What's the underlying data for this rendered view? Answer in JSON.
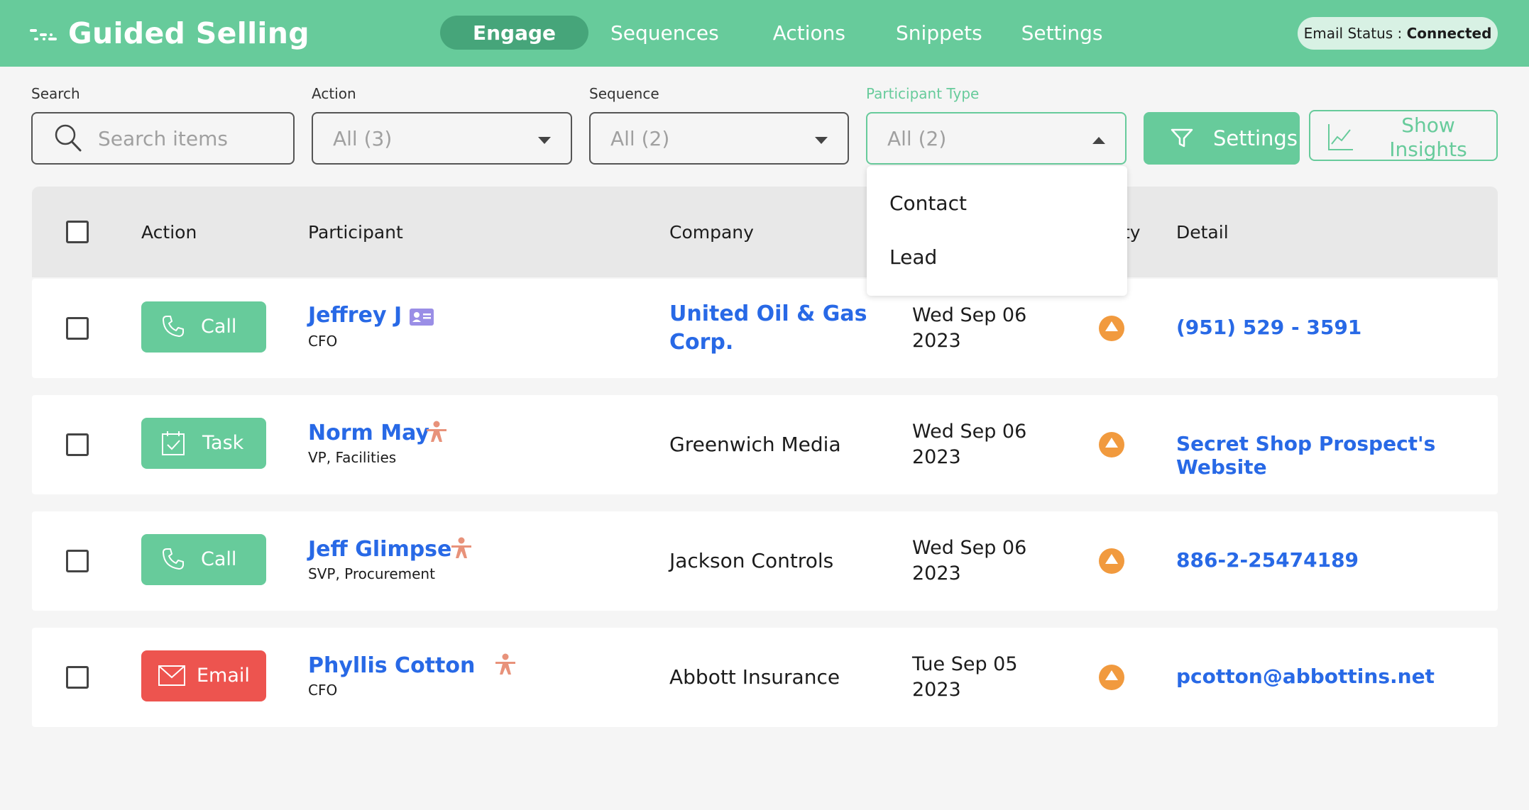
{
  "header": {
    "brand": "Guided Selling",
    "tabs": [
      {
        "label": "Engage",
        "active": true
      },
      {
        "label": "Sequences"
      },
      {
        "label": "Actions"
      },
      {
        "label": "Snippets"
      },
      {
        "label": "Settings"
      }
    ],
    "email_status_label": "Email Status :",
    "email_status_value": "Connected"
  },
  "filters": {
    "search": {
      "label": "Search",
      "placeholder": "Search items",
      "value": ""
    },
    "action": {
      "label": "Action",
      "value": "All (3)"
    },
    "sequence": {
      "label": "Sequence",
      "value": "All (2)"
    },
    "participant_type": {
      "label": "Participant Type",
      "value": "All (2)",
      "open": true,
      "options": [
        "Contact",
        "Lead"
      ]
    },
    "settings_button": "Settings",
    "insights_button_line1": "Show",
    "insights_button_line2": "Insights"
  },
  "table": {
    "headers": {
      "action": "Action",
      "participant": "Participant",
      "company": "Company",
      "priority_partial": "ty",
      "detail": "Detail"
    },
    "rows": [
      {
        "action": "Call",
        "action_type": "call",
        "name": "Jeffrey J",
        "title": "CFO",
        "participant_icon": "contact-card-icon",
        "company": [
          "United Oil & Gas",
          "Corp."
        ],
        "company_link": true,
        "date_line1": "Wed Sep 06",
        "date_line2": "2023",
        "priority": "up-arrow-icon",
        "detail": "(951) 529 - 3591"
      },
      {
        "action": "Task",
        "action_type": "task",
        "name": "Norm May",
        "title": "VP, Facilities",
        "participant_icon": "lead-person-icon",
        "company": [
          "Greenwich Media"
        ],
        "company_link": false,
        "date_line1": "Wed Sep 06",
        "date_line2": "2023",
        "priority": "up-arrow-icon",
        "detail": "Secret Shop Prospect's Website"
      },
      {
        "action": "Call",
        "action_type": "call",
        "name": "Jeff Glimpse",
        "title": "SVP, Procurement",
        "participant_icon": "lead-person-icon",
        "company": [
          "Jackson Controls"
        ],
        "company_link": false,
        "date_line1": "Wed Sep 06",
        "date_line2": "2023",
        "priority": "up-arrow-icon",
        "detail": "886-2-25474189"
      },
      {
        "action": "Email",
        "action_type": "email",
        "name": "Phyllis Cotton",
        "title": "CFO",
        "participant_icon": "lead-person-icon",
        "company": [
          "Abbott Insurance"
        ],
        "company_link": false,
        "date_line1": "Tue Sep 05",
        "date_line2": "2023",
        "priority": "up-arrow-icon",
        "detail": "pcotton@abbottins.net"
      }
    ]
  },
  "colors": {
    "brand_green": "#67cb9b",
    "active_tab": "#46a57a",
    "link_blue": "#2869e6",
    "email_red": "#ed544f",
    "priority_orange": "#f19a3e"
  }
}
